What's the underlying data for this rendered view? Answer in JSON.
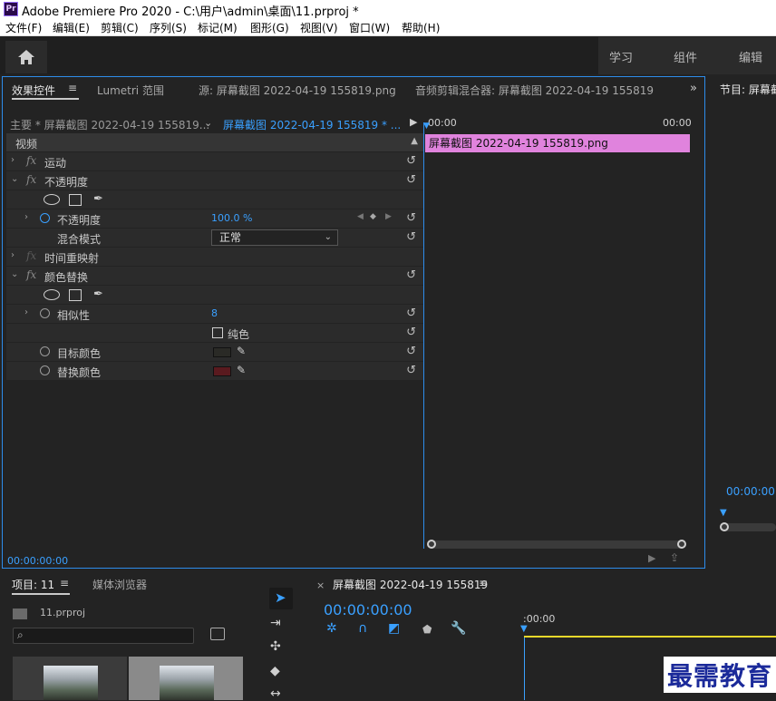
{
  "window": {
    "app_logo": "Pr",
    "title": "Adobe Premiere Pro 2020 - C:\\用户\\admin\\桌面\\11.prproj *"
  },
  "menu": [
    "文件(F)",
    "编辑(E)",
    "剪辑(C)",
    "序列(S)",
    "标记(M)",
    "图形(G)",
    "视图(V)",
    "窗口(W)",
    "帮助(H)"
  ],
  "workspace_tabs": [
    "学习",
    "组件",
    "编辑"
  ],
  "effect_panel": {
    "tabs": [
      "效果控件",
      "Lumetri 范围",
      "源: 屏幕截图 2022-04-19 155819.png",
      "音频剪辑混合器: 屏幕截图 2022-04-19 155819"
    ],
    "master_label": "主要 * 屏幕截图 2022-04-19 155819...",
    "sequence_label": "屏幕截图 2022-04-19 155819 * ...",
    "section_video": "视频",
    "rows": {
      "motion": "运动",
      "opacity_group": "不透明度",
      "opacity": "不透明度",
      "opacity_value": "100.0 %",
      "blend_mode": "混合模式",
      "blend_value": "正常",
      "time_remap": "时间重映射",
      "color_replace": "颜色替换",
      "similarity": "相似性",
      "similarity_value": "8",
      "solid_color": "纯色",
      "target_color": "目标颜色",
      "replace_color": "替换颜色"
    },
    "colors": {
      "target": "#2a2a26",
      "replace": "#5a1a1f",
      "clip": "#e083dd",
      "accent": "#2d8ceb"
    },
    "timecode_start": "00:00",
    "timecode_end": "00:00",
    "clip_name": "屏幕截图 2022-04-19  155819.png",
    "bottom_timecode": "00:00:00:00"
  },
  "program": {
    "title": "节目: 屏幕截",
    "timecode": "00:00:00"
  },
  "project_panel": {
    "tabs": [
      "项目: 11",
      "媒体浏览器"
    ],
    "file": "11.prproj"
  },
  "timeline": {
    "sequence_name": "屏幕截图 2022-04-19 155819",
    "timecode": "00:00:00:00",
    "ruler_start": ":00:00"
  },
  "watermark": "最需教育"
}
